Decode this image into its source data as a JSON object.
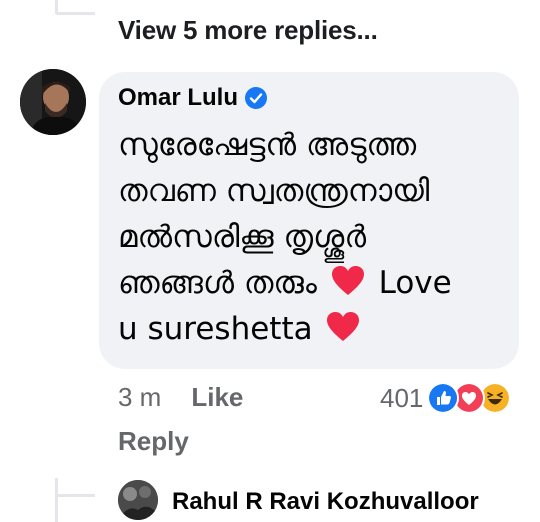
{
  "thread": {
    "view_more_label": "View 5 more replies..."
  },
  "comment": {
    "author": "Omar Lulu",
    "verified_icon": "verified-badge-icon",
    "text_line1": "സുരേഷേട്ടൻ അടുത്ത",
    "text_line2": "തവണ സ്വതന്ത്രനായി",
    "text_line3": "മൽസരിക്കൂ തൃശ്ശൂർ",
    "text_line4": "ഞങ്ങൾ തരും",
    "text_line4_tail": "Love",
    "text_line5": "u sureshetta",
    "heart_emoji": "heart-icon",
    "heart_color": "#f02849",
    "time": "3 m",
    "like_label": "Like",
    "reply_label": "Reply",
    "reaction_count": "401",
    "reaction_icons": [
      "like-reaction-icon",
      "love-reaction-icon",
      "haha-reaction-icon"
    ]
  },
  "next_comment": {
    "author": "Rahul R Ravi Kozhuvalloor"
  },
  "colors": {
    "bubble_bg": "#f0f2f5",
    "meta_text": "#65676b",
    "like_blue": "#1877f2",
    "love_red": "#f33e58",
    "haha_yellow": "#f7b125"
  }
}
